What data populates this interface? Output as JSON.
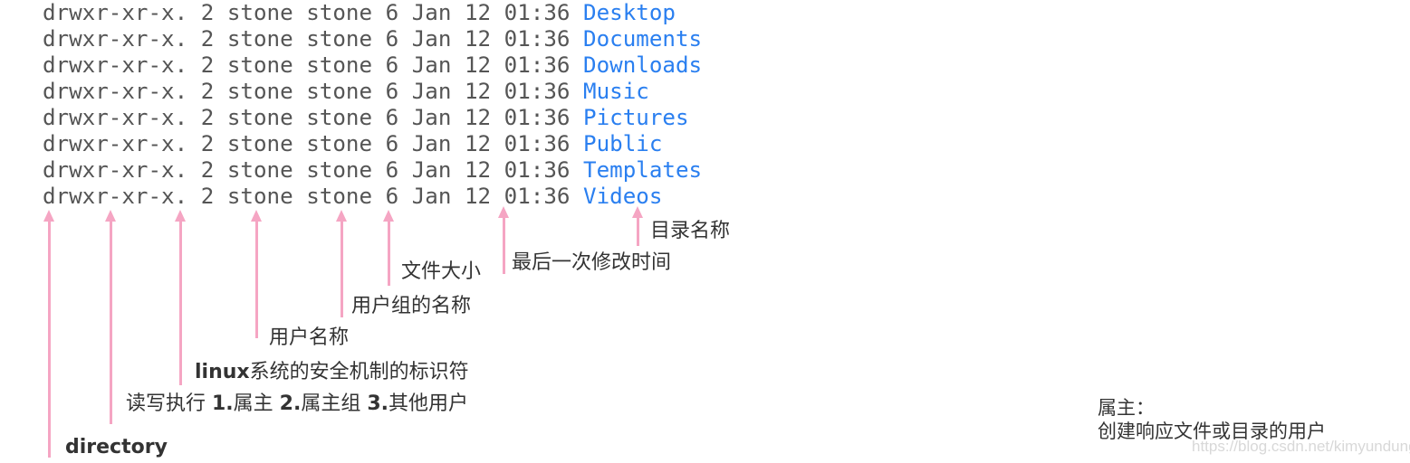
{
  "listing": {
    "perm": "drwxr-xr-x.",
    "links": "2",
    "owner": "stone",
    "group": "stone",
    "size": "6",
    "date": "Jan 12 01:36",
    "rows": [
      {
        "line": "drwxr-xr-x. 2 stone stone 6 Jan 12 01:36 ",
        "name": "Desktop"
      },
      {
        "line": "drwxr-xr-x. 2 stone stone 6 Jan 12 01:36 ",
        "name": "Documents"
      },
      {
        "line": "drwxr-xr-x. 2 stone stone 6 Jan 12 01:36 ",
        "name": "Downloads"
      },
      {
        "line": "drwxr-xr-x. 2 stone stone 6 Jan 12 01:36 ",
        "name": "Music"
      },
      {
        "line": "drwxr-xr-x. 2 stone stone 6 Jan 12 01:36 ",
        "name": "Pictures"
      },
      {
        "line": "drwxr-xr-x. 2 stone stone 6 Jan 12 01:36 ",
        "name": "Public"
      },
      {
        "line": "drwxr-xr-x. 2 stone stone 6 Jan 12 01:36 ",
        "name": "Templates"
      },
      {
        "line": "drwxr-xr-x. 2 stone stone 6 Jan 12 01:36 ",
        "name": "Videos"
      }
    ]
  },
  "colors": {
    "text": "#555555",
    "dir": "#2a7ff0",
    "arrow": "#f5a5c3"
  },
  "annotations": {
    "dirname": "目录名称",
    "mtime": "最后一次修改时间",
    "size": "文件大小",
    "group": "用户组的名称",
    "owner": "用户名称",
    "selinux_bold": "linux",
    "selinux_rest": "系统的安全机制的标识符",
    "rwx_a": "读写执行 ",
    "rwx_b1": "1.",
    "rwx_c1": "属主 ",
    "rwx_b2": "2.",
    "rwx_c2": "属主组 ",
    "rwx_b3": "3.",
    "rwx_c3": "其他用户",
    "directory": "directory"
  },
  "note": {
    "title": "属主：",
    "body": "创建响应文件或目录的用户"
  },
  "watermark": "https://blog.csdn.net/kimyundung"
}
